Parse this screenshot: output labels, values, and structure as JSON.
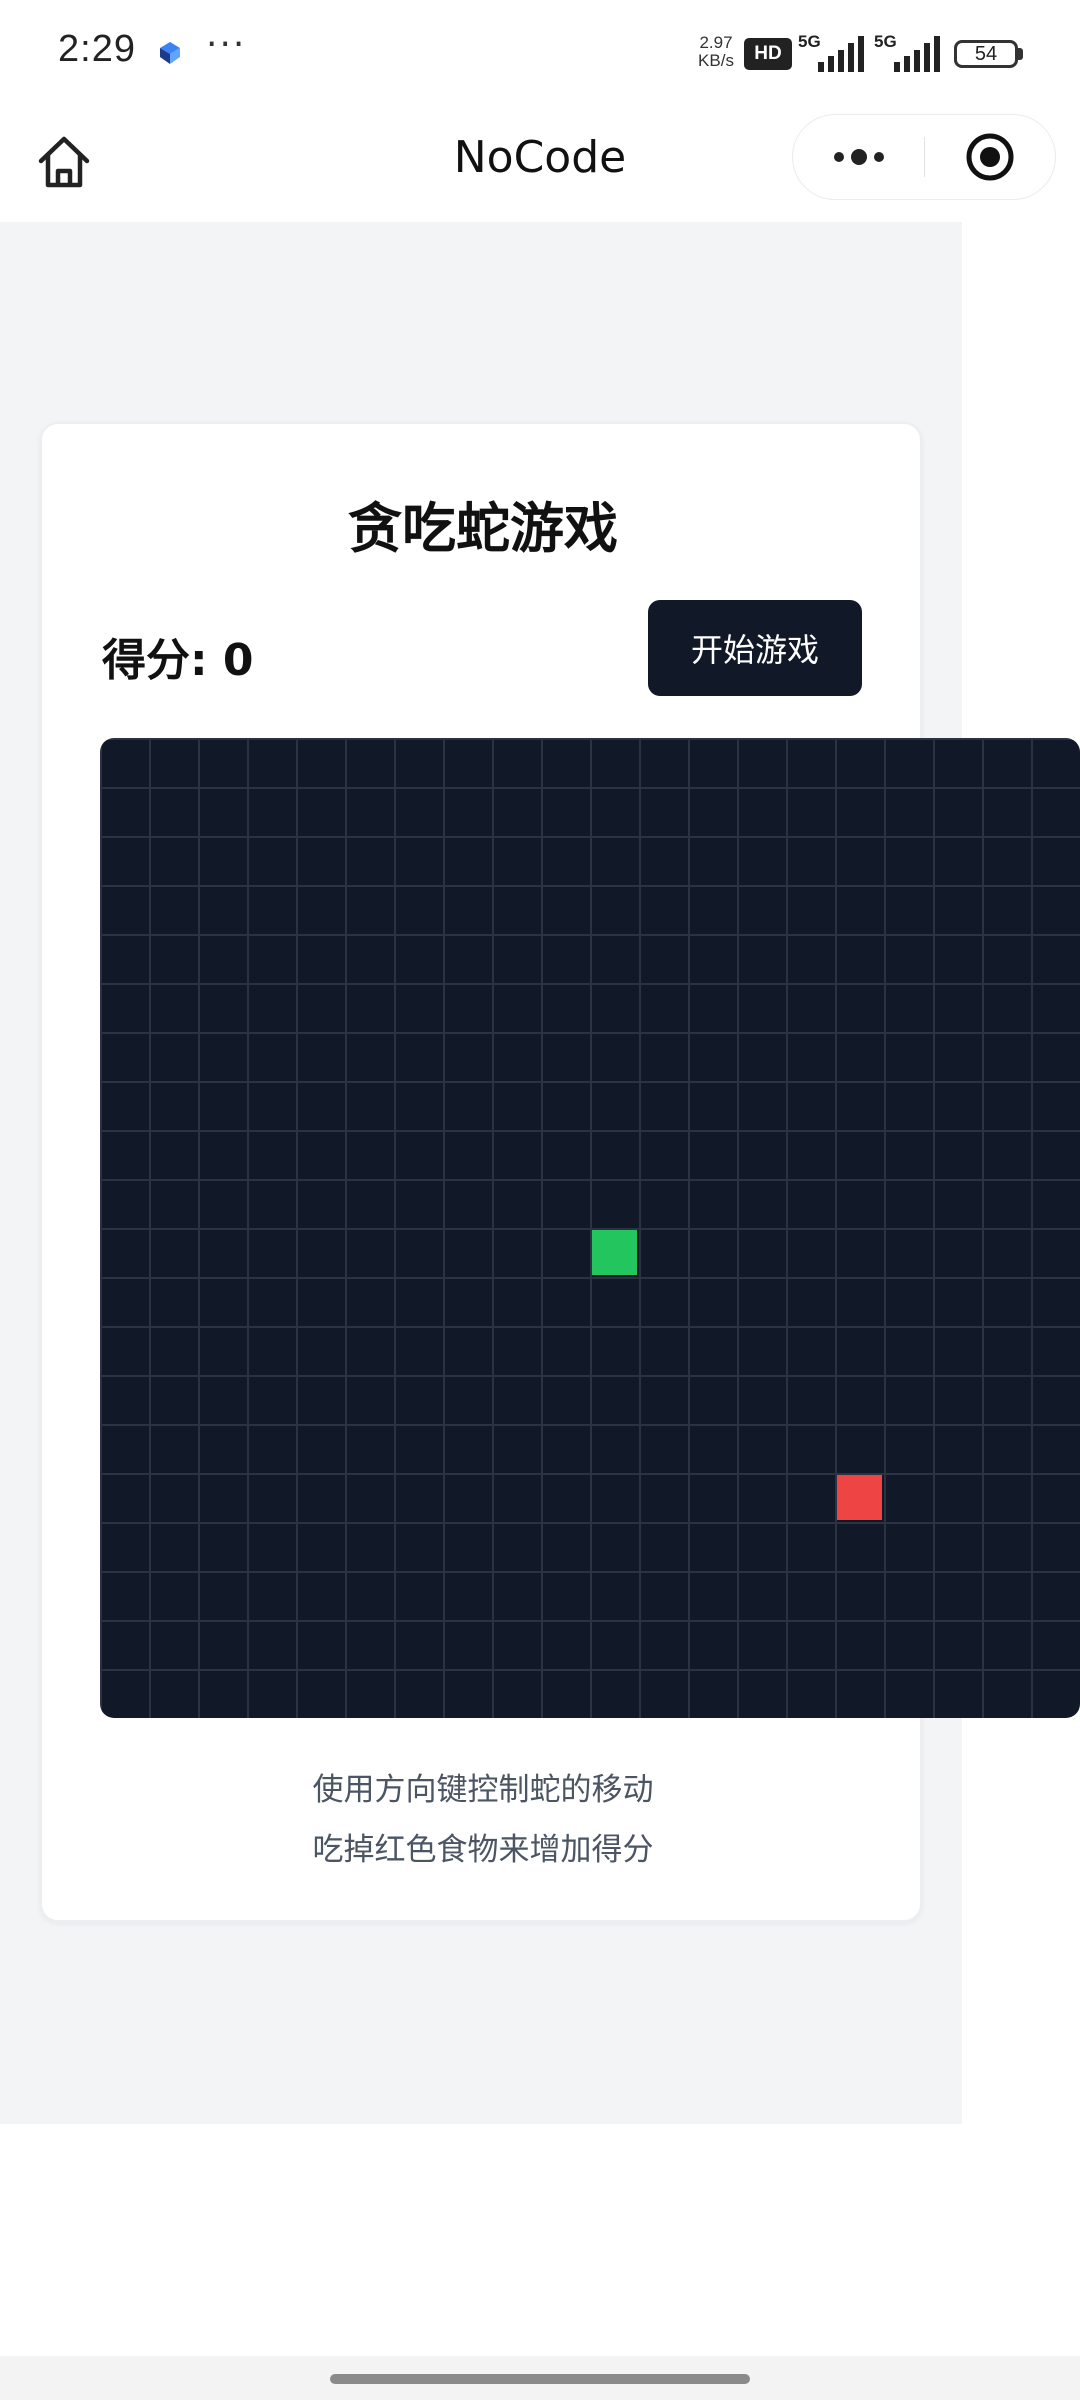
{
  "status_bar": {
    "time": "2:29",
    "more": "···",
    "net_speed_value": "2.97",
    "net_speed_unit": "KB/s",
    "hd_label": "HD",
    "sim1_tech": "5G",
    "sim2_tech": "5G",
    "battery_level": "54"
  },
  "title_bar": {
    "title": "NoCode"
  },
  "game": {
    "title": "贪吃蛇游戏",
    "score_label": "得分: ",
    "score_value": "0",
    "start_label": "开始游戏",
    "grid": {
      "columns": 20,
      "rows": 20,
      "snake": [
        {
          "col": 10,
          "row": 10
        }
      ],
      "food": {
        "col": 15,
        "row": 15
      }
    },
    "instructions": [
      "使用方向键控制蛇的移动",
      "吃掉红色食物来增加得分"
    ]
  },
  "colors": {
    "board": "#111827",
    "grid_line": "#2b3342",
    "snake": "#22c55e",
    "food": "#ef4444",
    "button": "#111827",
    "page_bg": "#f3f4f6"
  }
}
